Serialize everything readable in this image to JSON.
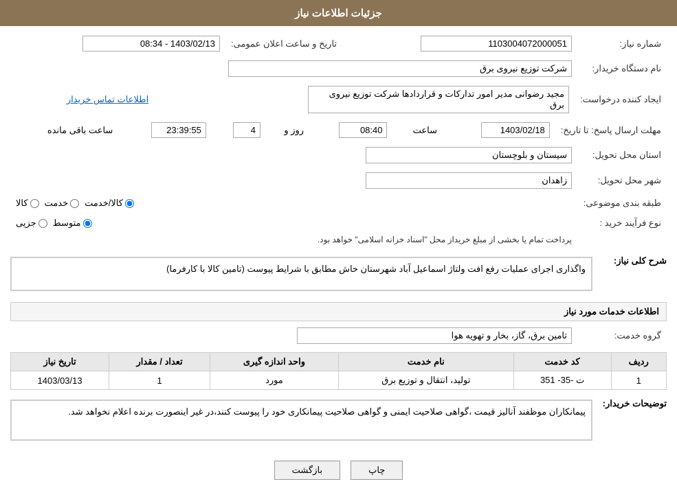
{
  "header": {
    "title": "جزئیات اطلاعات نیاز"
  },
  "fields": {
    "shomareNiaz_label": "شماره نیاز:",
    "shomareNiaz_value": "1103004072000051",
    "namDasgah_label": "نام دستگاه خریدار:",
    "namDasgah_value": "شرکت توزیع نیروی برق",
    "ijadKonande_label": "ایجاد کننده درخواست:",
    "ijadKonande_value": "مجید  رضوانی مدیر امور تدارکات و قراردادها شرکت توزیع نیروی برق",
    "ijadKonande_link": "اطلاعات تماس خریدار",
    "mohlat_label": "مهلت ارسال پاسخ: تا تاریخ:",
    "mohlat_date": "1403/02/18",
    "mohlat_time_label": "ساعت",
    "mohlat_time": "08:40",
    "mohlat_roz_label": "روز و",
    "mohlat_roz": "4",
    "mohlat_saatBaghiMande_label": "ساعت باقی مانده",
    "mohlat_countdown": "23:39:55",
    "ostan_label": "استان محل تحویل:",
    "ostan_value": "سیستان و بلوچستان",
    "shahr_label": "شهر محل تحویل:",
    "shahr_value": "زاهدان",
    "tabaqe_label": "طبقه بندی موضوعی:",
    "tabaqe_kala": "کالا",
    "tabaqe_khadamat": "خدمت",
    "tabaqe_kala_khadamat": "کالا/خدمت",
    "noFarayand_label": "نوع فرآیند خرید :",
    "noFarayand_jozi": "جزیی",
    "noFarayand_motavaset": "متوسط",
    "noFarayand_text": "پرداخت تمام یا بخشی از مبلغ خریداز محل \"اسناد خزانه اسلامی\" خواهد بود.",
    "tarikh_label": "تاریخ و ساعت اعلان عمومی:",
    "tarikh_value": "1403/02/13 - 08:34",
    "sharhKoli_label": "شرح کلی نیاز:",
    "sharhKoli_value": "واگذاری اجرای عملیات رفع افت ولتاژ اسماعیل آباد شهرستان خاش مطابق با شرایط پیوست (تامین کالا با کارفرما)",
    "khadamatTitle": "اطلاعات خدمات مورد نیاز",
    "grohKhadamat_label": "گروه خدمت:",
    "grohKhadamat_value": "تامین برق، گاز، بخار و تهویه هوا",
    "table": {
      "col_radif": "ردیف",
      "col_kodKhadamat": "کد خدمت",
      "col_namKhadamat": "نام خدمت",
      "col_vahedAndaze": "واحد اندازه گیری",
      "col_tedad": "تعداد / مقدار",
      "col_tarikh": "تاریخ نیاز",
      "rows": [
        {
          "radif": "1",
          "kodKhadamat": "ت -35- 351",
          "namKhadamat": "تولید، انتقال و توزیع برق",
          "vahedAndaze": "مورد",
          "tedad": "1",
          "tarikh": "1403/03/13"
        }
      ]
    },
    "tozihat_label": "توضیحات خریدار:",
    "tozihat_value": "پیمانکاران موظفند آنالیز قیمت ،گواهی صلاحیت ایمنی و گواهی صلاحیت پیمانکاری خود را پیوست کنند،در غیر اینصورت برنده اعلام نخواهد شد."
  },
  "buttons": {
    "print_label": "چاپ",
    "back_label": "بازگشت"
  }
}
